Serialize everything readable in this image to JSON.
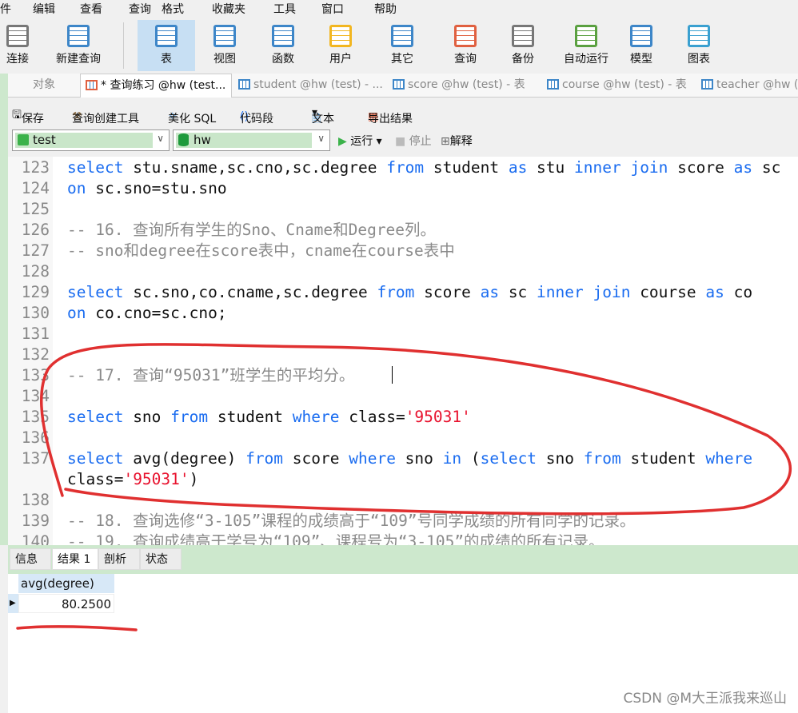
{
  "menu": [
    "件",
    "编辑",
    "查看",
    "查询",
    "格式",
    "收藏夹",
    "工具",
    "窗口",
    "帮助"
  ],
  "toolbar": [
    {
      "label": "连接",
      "icon": "plug-icon"
    },
    {
      "label": "新建查询",
      "icon": "new-query-icon"
    },
    {
      "label": "表",
      "icon": "table-icon",
      "active": true
    },
    {
      "label": "视图",
      "icon": "view-icon"
    },
    {
      "label": "函数",
      "icon": "function-icon"
    },
    {
      "label": "用户",
      "icon": "user-icon"
    },
    {
      "label": "其它",
      "icon": "tools-icon"
    },
    {
      "label": "查询",
      "icon": "query-icon"
    },
    {
      "label": "备份",
      "icon": "backup-icon"
    },
    {
      "label": "自动运行",
      "icon": "schedule-icon"
    },
    {
      "label": "模型",
      "icon": "model-icon"
    },
    {
      "label": "图表",
      "icon": "chart-icon"
    }
  ],
  "tabs": [
    "对象",
    "* 查询练习 @hw (test...",
    "student @hw (test) - ...",
    "score @hw (test) - 表",
    "course @hw (test) - 表",
    "teacher @hw ("
  ],
  "query_toolbar": {
    "save": "保存",
    "builder": "查询创建工具",
    "beautify": "美化 SQL",
    "snippet": "代码段",
    "text": "文本",
    "export": "导出结果",
    "run": "运行",
    "stop": "停止",
    "explain": "解释"
  },
  "connection": "test",
  "database": "hw",
  "code": [
    {
      "n": "123",
      "t": [
        [
          "k",
          "select"
        ],
        [
          "p",
          " stu.sname,sc.cno,sc.degree "
        ],
        [
          "k",
          "from"
        ],
        [
          "p",
          " student "
        ],
        [
          "k",
          "as"
        ],
        [
          "p",
          " stu "
        ],
        [
          "k",
          "inner join"
        ],
        [
          "p",
          " score "
        ],
        [
          "k",
          "as"
        ],
        [
          "p",
          " sc"
        ]
      ]
    },
    {
      "n": "124",
      "t": [
        [
          "k",
          "on"
        ],
        [
          "p",
          " sc.sno=stu.sno"
        ]
      ]
    },
    {
      "n": "125",
      "t": []
    },
    {
      "n": "126",
      "t": [
        [
          "c",
          "-- 16. 查询所有学生的Sno、Cname和Degree列。"
        ]
      ]
    },
    {
      "n": "127",
      "t": [
        [
          "c",
          "-- sno和degree在score表中，cname在course表中"
        ]
      ]
    },
    {
      "n": "128",
      "t": []
    },
    {
      "n": "129",
      "t": [
        [
          "k",
          "select"
        ],
        [
          "p",
          " sc.sno,co.cname,sc.degree "
        ],
        [
          "k",
          "from"
        ],
        [
          "p",
          " score "
        ],
        [
          "k",
          "as"
        ],
        [
          "p",
          " sc "
        ],
        [
          "k",
          "inner join"
        ],
        [
          "p",
          " course "
        ],
        [
          "k",
          "as"
        ],
        [
          "p",
          " co"
        ]
      ]
    },
    {
      "n": "130",
      "t": [
        [
          "k",
          "on"
        ],
        [
          "p",
          " co.cno=sc.cno;"
        ]
      ]
    },
    {
      "n": "131",
      "t": []
    },
    {
      "n": "132",
      "t": []
    },
    {
      "n": "133",
      "t": [
        [
          "c",
          "-- 17. 查询“95031”班学生的平均分。"
        ]
      ]
    },
    {
      "n": "134",
      "t": []
    },
    {
      "n": "135",
      "t": [
        [
          "k",
          "select"
        ],
        [
          "p",
          " sno "
        ],
        [
          "k",
          "from"
        ],
        [
          "p",
          " student "
        ],
        [
          "k",
          "where"
        ],
        [
          "p",
          " class="
        ],
        [
          "s",
          "'95031'"
        ]
      ]
    },
    {
      "n": "136",
      "t": []
    },
    {
      "n": "137",
      "t": [
        [
          "k",
          "select"
        ],
        [
          "p",
          " avg(degree) "
        ],
        [
          "k",
          "from"
        ],
        [
          "p",
          " score "
        ],
        [
          "k",
          "where"
        ],
        [
          "p",
          " sno "
        ],
        [
          "k",
          "in"
        ],
        [
          "p",
          " ("
        ],
        [
          "k",
          "select"
        ],
        [
          "p",
          " sno "
        ],
        [
          "k",
          "from"
        ],
        [
          "p",
          " student "
        ],
        [
          "k",
          "where"
        ]
      ]
    },
    {
      "n": "",
      "t": [
        [
          "p",
          "class="
        ],
        [
          "s",
          "'95031'"
        ],
        [
          "p",
          ")"
        ]
      ]
    },
    {
      "n": "138",
      "t": []
    },
    {
      "n": "139",
      "t": [
        [
          "c",
          "-- 18. 查询选修“3-105”课程的成绩高于“109”号同学成绩的所有同学的记录。"
        ]
      ]
    },
    {
      "n": "140",
      "t": [
        [
          "c",
          "-- 19. 查询成绩高于学号为“109”、课程号为“3-105”的成绩的所有记录。"
        ]
      ]
    }
  ],
  "result_tabs": [
    "信息",
    "结果 1",
    "剖析",
    "状态"
  ],
  "result": {
    "columns": [
      "avg(degree)"
    ],
    "rows": [
      [
        "80.2500"
      ]
    ]
  },
  "watermark": "CSDN @M大王派我来巡山",
  "colors": {
    "keyword": "#1a6cf0",
    "comment": "#8a8a8a",
    "string": "#e8112d",
    "annotation": "#e03030",
    "accent_green": "#cde8cd"
  }
}
